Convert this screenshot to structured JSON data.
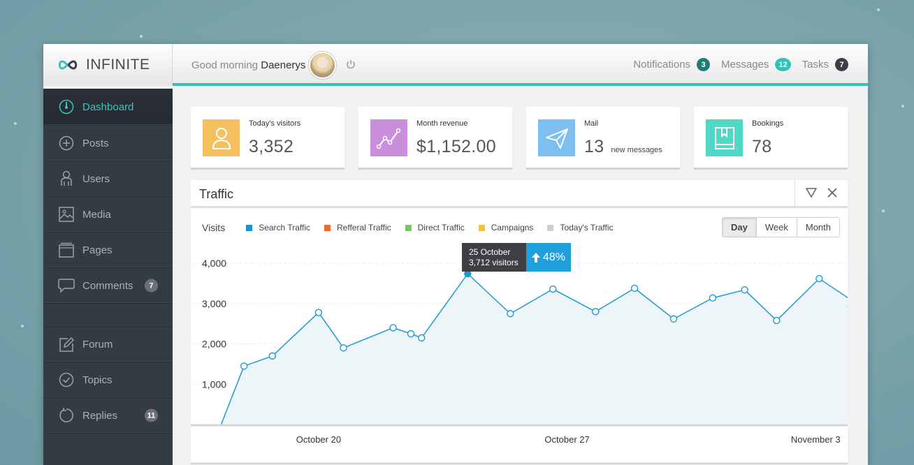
{
  "app": {
    "brand": "INFINITE",
    "greeting": "Good morning",
    "user_name": "Daenerys",
    "accent_color": "#3cbfb5"
  },
  "topnav": [
    {
      "label": "Notifications",
      "count": "3",
      "color": "#1f7d72",
      "icon": "notifications"
    },
    {
      "label": "Messages",
      "count": "12",
      "color": "#33c2b8",
      "icon": "messages"
    },
    {
      "label": "Tasks",
      "count": "7",
      "color": "#3a3f47",
      "icon": "tasks"
    }
  ],
  "sidebar": {
    "items": [
      {
        "label": "Dashboard",
        "icon": "gauge-icon",
        "active": true,
        "count": ""
      },
      {
        "label": "Posts",
        "icon": "plus-circle-icon",
        "count": ""
      },
      {
        "label": "Users",
        "icon": "user-icon",
        "count": ""
      },
      {
        "label": "Media",
        "icon": "image-icon",
        "count": ""
      },
      {
        "label": "Pages",
        "icon": "pages-icon",
        "count": ""
      },
      {
        "label": "Comments",
        "icon": "comment-icon",
        "count": "7"
      },
      {
        "label": "Forum",
        "icon": "pencil-icon",
        "count": ""
      },
      {
        "label": "Topics",
        "icon": "check-circle-icon",
        "count": ""
      },
      {
        "label": "Replies",
        "icon": "refresh-icon",
        "count": "11"
      }
    ]
  },
  "cards": [
    {
      "label": "Today's visitors",
      "value": "3,352",
      "sub": "",
      "color": "#f6c061",
      "icon": "user-outline-icon"
    },
    {
      "label": "Month revenue",
      "value": "$1,152.00",
      "sub": "",
      "color": "#c98fdb",
      "icon": "trend-line-icon"
    },
    {
      "label": "Mail",
      "value": "13",
      "sub": "new messages",
      "color": "#7cbff0",
      "icon": "paper-plane-icon"
    },
    {
      "label": "Bookings",
      "value": "78",
      "sub": "",
      "color": "#4fd8c6",
      "icon": "book-icon"
    }
  ],
  "traffic": {
    "title": "Traffic",
    "visits_label": "Visits",
    "legend": [
      {
        "label": "Search Traffic",
        "color": "#1b8fd0"
      },
      {
        "label": "Refferal Traffic",
        "color": "#f06a35"
      },
      {
        "label": "Direct Traffic",
        "color": "#7cc36b"
      },
      {
        "label": "Campaigns",
        "color": "#f7c431"
      },
      {
        "label": "Today's Traffic",
        "color": "#cfcfcf"
      }
    ],
    "ranges": [
      "Day",
      "Week",
      "Month"
    ],
    "selected_range": "Day",
    "tooltip": {
      "date": "25 October",
      "visitors": "3,712 visitors",
      "change": "48%"
    }
  },
  "chart_data": {
    "type": "area",
    "title": "Traffic",
    "ylabel": "Visits",
    "ylim": [
      0,
      4400
    ],
    "yticks": [
      "1,000",
      "2,000",
      "3,000",
      "4,000"
    ],
    "ytick_values": [
      1000,
      2000,
      3000,
      4000
    ],
    "xlim": [
      16.4,
      34.9
    ],
    "xtick_labels": [
      "October 20",
      "October 27",
      "November 3"
    ],
    "xtick_values": [
      20,
      27,
      34
    ],
    "series": [
      {
        "name": "Search Traffic",
        "x": [
          17.9,
          18.7,
          20.0,
          20.7,
          22.1,
          22.6,
          22.9,
          24.2,
          25.4,
          26.6,
          27.8,
          28.9,
          30.0,
          31.1,
          32.0,
          32.9,
          34.1,
          35.0
        ],
        "y": [
          1450,
          1700,
          2780,
          1900,
          2400,
          2250,
          2150,
          3740,
          2750,
          3360,
          2800,
          3380,
          2620,
          3140,
          3340,
          2580,
          3620,
          3090
        ],
        "highlight_index": 7
      }
    ],
    "tail": {
      "x": [
        35.0,
        36.0
      ],
      "y": [
        3090,
        3480,
        3190
      ]
    }
  }
}
